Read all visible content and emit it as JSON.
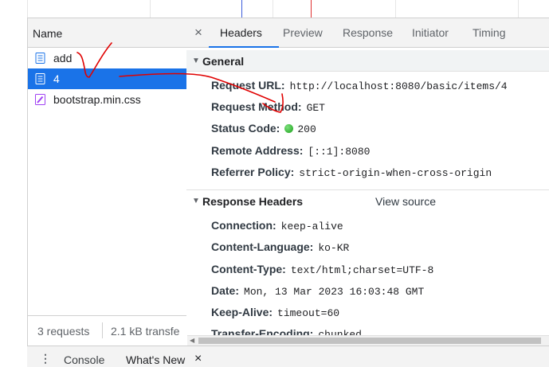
{
  "left_panel": {
    "column_header": "Name",
    "requests": [
      {
        "name": "add",
        "icon": "document-icon"
      },
      {
        "name": "4",
        "icon": "document-icon",
        "selected": true
      },
      {
        "name": "bootstrap.min.css",
        "icon": "stylesheet-icon"
      }
    ],
    "status": {
      "requests": "3 requests",
      "transferred": "2.1 kB transfe"
    }
  },
  "tabs": {
    "close": "×",
    "items": [
      "Headers",
      "Preview",
      "Response",
      "Initiator",
      "Timing"
    ],
    "active": "Headers"
  },
  "general": {
    "title": "General",
    "rows": [
      {
        "key": "Request URL:",
        "value": "http://localhost:8080/basic/items/4"
      },
      {
        "key": "Request Method:",
        "value": "GET"
      },
      {
        "key": "Status Code:",
        "value": "200"
      },
      {
        "key": "Remote Address:",
        "value": "[::1]:8080"
      },
      {
        "key": "Referrer Policy:",
        "value": "strict-origin-when-cross-origin"
      }
    ]
  },
  "response_headers": {
    "title": "Response Headers",
    "view_source": "View source",
    "rows": [
      {
        "key": "Connection:",
        "value": "keep-alive"
      },
      {
        "key": "Content-Language:",
        "value": "ko-KR"
      },
      {
        "key": "Content-Type:",
        "value": "text/html;charset=UTF-8"
      },
      {
        "key": "Date:",
        "value": "Mon, 13 Mar 2023 16:03:48 GMT"
      },
      {
        "key": "Keep-Alive:",
        "value": "timeout=60"
      },
      {
        "key": "Transfer-Encoding:",
        "value": "chunked"
      }
    ]
  },
  "drawer": {
    "menu_icon": "⋮",
    "console": "Console",
    "whats_new": "What's New",
    "close": "×"
  },
  "colors": {
    "selection": "#1a73e8",
    "status_ok": "#1aa01a",
    "annotation": "#e00000"
  }
}
